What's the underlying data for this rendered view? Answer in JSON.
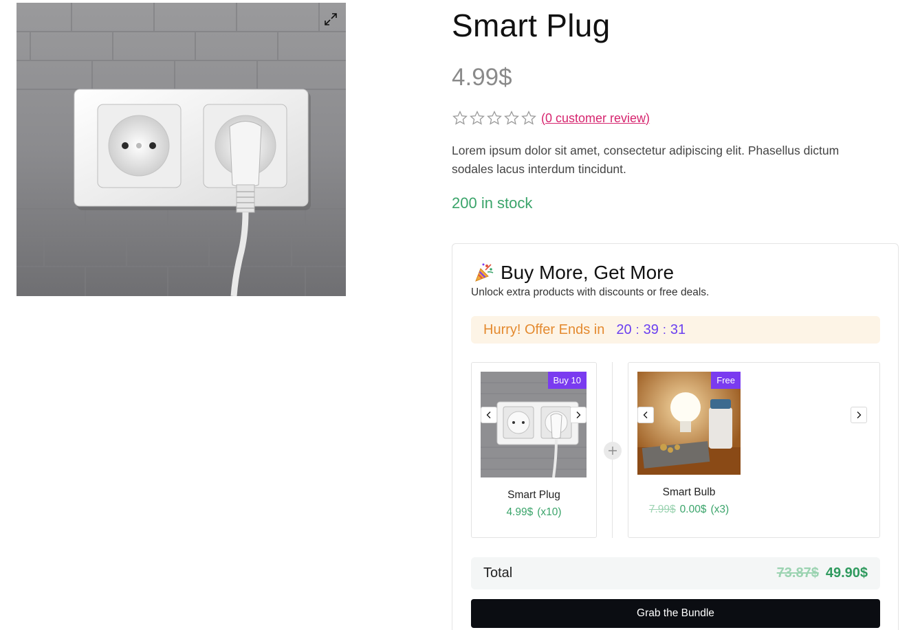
{
  "product": {
    "title": "Smart Plug",
    "price": "4.99$",
    "rating": {
      "value": 0,
      "max": 5,
      "review_link": "(0 customer review)"
    },
    "description": "Lorem ipsum dolor sit amet, consectetur adipiscing elit. Phasellus dictum sodales lacus interdum tincidunt.",
    "stock": "200 in stock",
    "image_icon": "expand-icon"
  },
  "bundle": {
    "title": "Buy More, Get More",
    "subtitle": "Unlock extra products with discounts or free deals.",
    "timer": {
      "label": "Hurry! Offer Ends in",
      "hours": "20",
      "minutes": "39",
      "seconds": "31",
      "separator": ":"
    },
    "items": [
      {
        "name": "Smart Plug",
        "badge": "Buy 10",
        "price": "4.99$",
        "qty": "(x10)"
      },
      {
        "name": "Smart Bulb",
        "badge": "Free",
        "old_price": "7.99$",
        "price": "0.00$",
        "qty": "(x3)"
      }
    ],
    "total": {
      "label": "Total",
      "old": "73.87$",
      "new": "49.90$"
    },
    "button": "Grab the Bundle"
  },
  "colors": {
    "accent_purple": "#7a3bf0",
    "price_green": "#3aa46a",
    "review_pink": "#d6246e",
    "timer_orange": "#e48a2f"
  }
}
